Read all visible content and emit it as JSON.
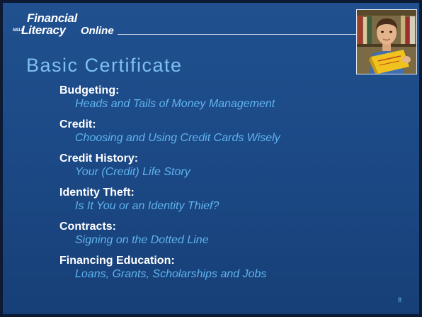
{
  "logo": {
    "financial": "Financial",
    "nslp": "NSLP",
    "literacy": "Literacy",
    "online": "Online"
  },
  "slide": {
    "title": "Basic Certificate",
    "page_number": "8",
    "colors": {
      "background": "#1c4a87",
      "title": "#7ec0f2",
      "subtitle": "#5fb3ee",
      "label": "#ffffff"
    }
  },
  "topics": [
    {
      "label": "Budgeting:",
      "subtitle": "Heads and Tails of Money Management"
    },
    {
      "label": "Credit:",
      "subtitle": "Choosing and Using Credit Cards Wisely"
    },
    {
      "label": "Credit History:",
      "subtitle": "Your (Credit) Life Story"
    },
    {
      "label": "Identity Theft:",
      "subtitle": "Is It You or an Identity Thief?"
    },
    {
      "label": "Contracts:",
      "subtitle": "Signing on the Dotted Line"
    },
    {
      "label": "Financing Education:",
      "subtitle": "Loans, Grants, Scholarships and Jobs"
    }
  ],
  "photo": {
    "icon": "student-with-books-photo"
  }
}
